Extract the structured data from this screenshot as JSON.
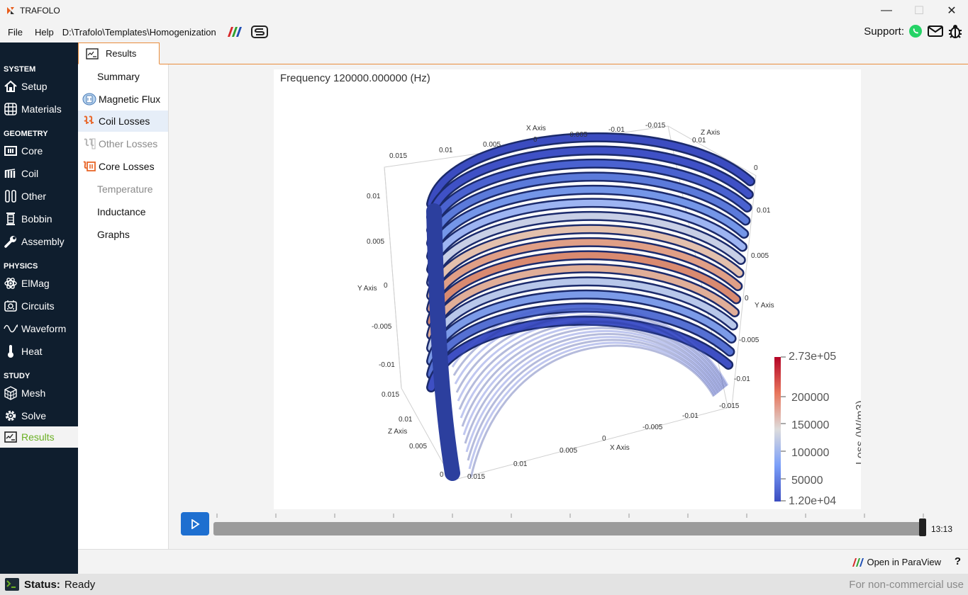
{
  "window": {
    "title": "TRAFOLO",
    "minimize": "—",
    "maximize": "☐",
    "close": "✕"
  },
  "menu": {
    "file": "File",
    "help": "Help",
    "path": "D:\\Trafolo\\Templates\\Homogenization"
  },
  "support": {
    "label": "Support:"
  },
  "sidebar": {
    "sections": {
      "system": "SYSTEM",
      "geometry": "GEOMETRY",
      "physics": "PHYSICS",
      "study": "STUDY"
    },
    "items": {
      "setup": "Setup",
      "materials": "Materials",
      "core": "Core",
      "coil": "Coil",
      "other": "Other",
      "bobbin": "Bobbin",
      "assembly": "Assembly",
      "elmag": "ElMag",
      "circuits": "Circuits",
      "waveform": "Waveform",
      "heat": "Heat",
      "mesh": "Mesh",
      "solve": "Solve",
      "results": "Results"
    }
  },
  "tab": {
    "results": "Results"
  },
  "subnav": {
    "summary": "Summary",
    "magnetic_flux": "Magnetic Flux",
    "coil_losses": "Coil Losses",
    "other_losses": "Other Losses",
    "core_losses": "Core Losses",
    "temperature": "Temperature",
    "inductance": "Inductance",
    "graphs": "Graphs"
  },
  "viewer": {
    "frequency": "Frequency 120000.000000 (Hz)",
    "x_axis": "X Axis",
    "y_axis": "Y Axis",
    "z_axis": "Z Axis",
    "top_x_ticks": [
      "0.015",
      "0.01",
      "0.005",
      "0",
      "-0.005",
      "-0.01",
      "-0.015"
    ],
    "left_y_ticks": [
      "0.01",
      "0.005",
      "0",
      "-0.005",
      "-0.01"
    ],
    "right_y_ticks": [
      "0.01",
      "0.005",
      "0",
      "-0.005",
      "-0.01",
      "-0.015"
    ],
    "bottom_x_ticks": [
      "0.015",
      "0.01",
      "0.005",
      "0",
      "-0.005",
      "-0.01"
    ],
    "z_ticks_left": [
      "0.015",
      "0.01",
      "0.005",
      "0"
    ],
    "z_ticks_top": [
      "0.01",
      "0"
    ],
    "colorbar": {
      "max": "2.73e+05",
      "t200": "200000",
      "t150": "150000",
      "t100": "100000",
      "t50": "50000",
      "min": "1.20e+04",
      "title": "Loss (W/m3)"
    }
  },
  "timeline": {
    "time": "13:13",
    "position": 1.0
  },
  "bottom": {
    "open_paraview": "Open in ParaView",
    "help": "?"
  },
  "status": {
    "label": "Status:",
    "value": "Ready",
    "license": "For non-commercial use"
  },
  "colors": {
    "sidebar_bg": "#0f1e2e",
    "accent_orange": "#e88c3c",
    "active_green": "#6ab023",
    "play_blue": "#1e6fd0"
  }
}
